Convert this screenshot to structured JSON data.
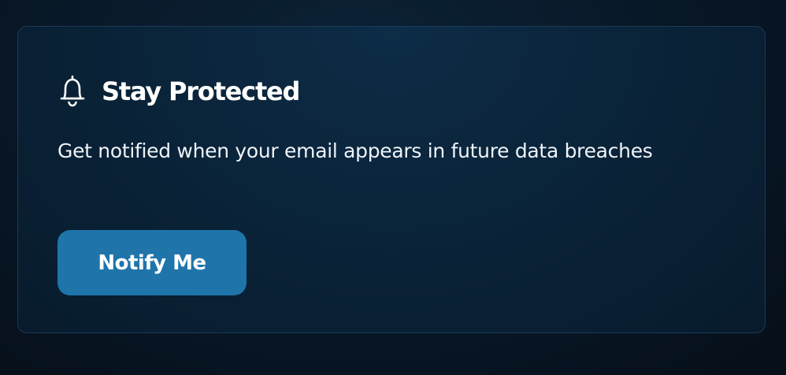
{
  "card": {
    "icon": "bell-icon",
    "title": "Stay Protected",
    "description": "Get notified when your email appears in future data breaches",
    "button_label": "Notify Me"
  },
  "colors": {
    "accent": "#1f74aa",
    "background": "#081726",
    "card_background": "#0a2338",
    "card_border": "#1a3a55",
    "text": "#ffffff"
  }
}
